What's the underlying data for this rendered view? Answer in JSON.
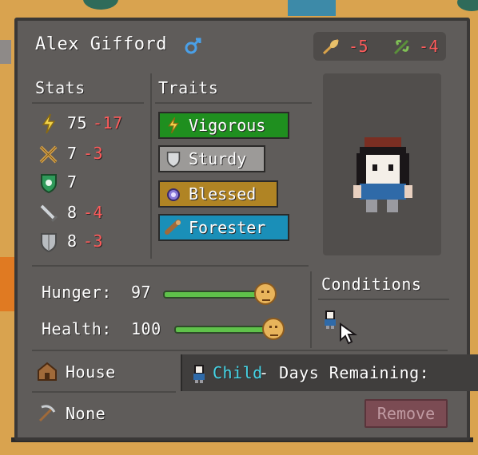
{
  "character": {
    "name": "Alex Gifford",
    "gender_icon": "male-symbol-icon",
    "header_stats": [
      {
        "icon": "wheat-icon",
        "value": "-5"
      },
      {
        "icon": "herb-icon",
        "value": "-4"
      }
    ]
  },
  "stats": {
    "title": "Stats",
    "rows": [
      {
        "icon": "lightning-icon",
        "value": "75",
        "modifier": "-17"
      },
      {
        "icon": "crossed-tools-icon",
        "value": "7",
        "modifier": "-3"
      },
      {
        "icon": "shield-green-icon",
        "value": "7",
        "modifier": ""
      },
      {
        "icon": "sword-icon",
        "value": "8",
        "modifier": "-4"
      },
      {
        "icon": "shield-grey-icon",
        "value": "8",
        "modifier": "-3"
      }
    ]
  },
  "traits": {
    "title": "Traits",
    "items": [
      {
        "label": "Vigorous",
        "color": "#1f8f1f",
        "icon": "lightning-icon"
      },
      {
        "label": "Sturdy",
        "color": "#9c9a98",
        "icon": "shield-icon"
      },
      {
        "label": "Blessed",
        "color": "#b08424",
        "icon": "blessed-orb-icon"
      },
      {
        "label": "Forester",
        "color": "#1a8fb8",
        "icon": "log-icon"
      }
    ]
  },
  "needs": {
    "hunger_label": "Hunger:",
    "hunger_value": "97",
    "hunger_level": 0.97,
    "health_label": "Health:",
    "health_value": "100",
    "health_level": 1.0
  },
  "conditions": {
    "title": "Conditions",
    "icon": "child-icon"
  },
  "assignment": {
    "home_icon": "house-icon",
    "home_label": "House",
    "job_icon": "pickaxe-icon",
    "job_label": "None",
    "remove_label": "Remove"
  },
  "tooltip": {
    "icon": "child-icon",
    "highlight": "Child",
    "text": " - Days Remaining:"
  },
  "colors": {
    "panel": "#5f5c5a",
    "negative": "#ff5b5b",
    "highlight": "#45d6e8"
  }
}
